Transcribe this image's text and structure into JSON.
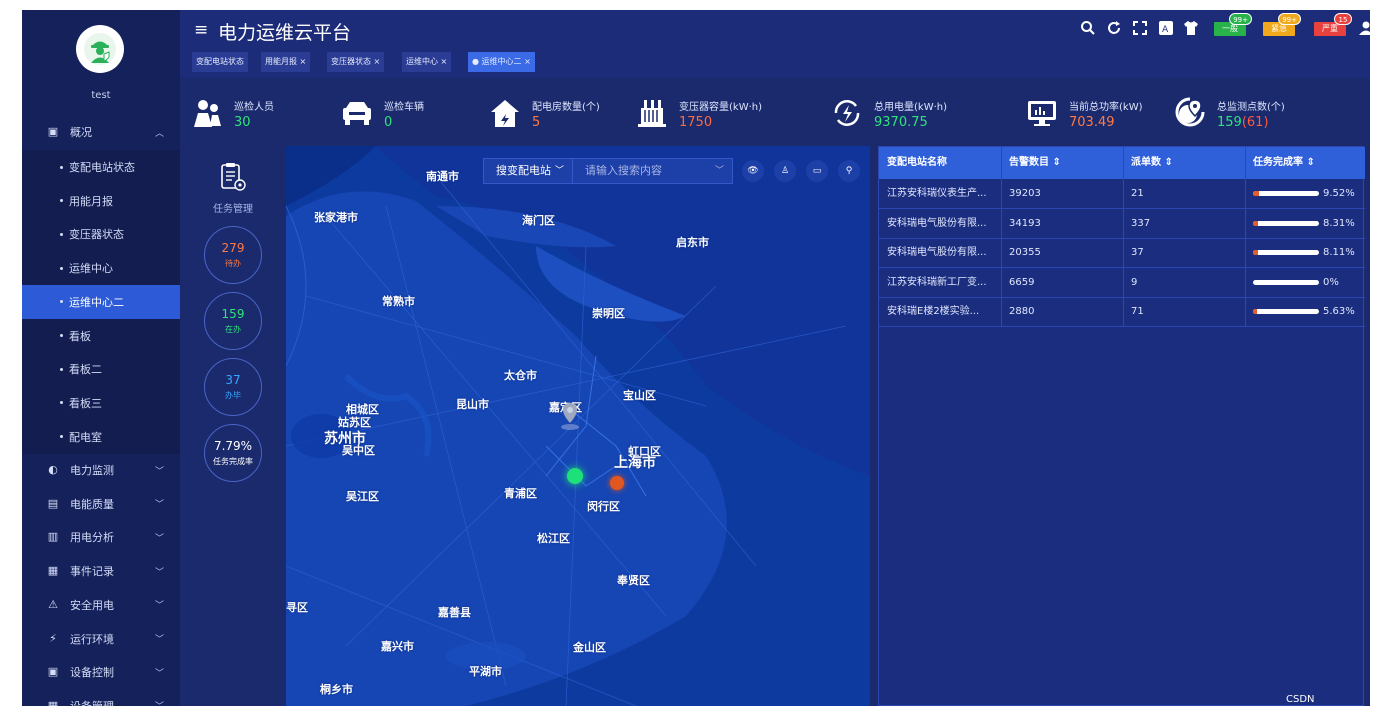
{
  "sidebar": {
    "username": "test",
    "overview": {
      "label": "概况"
    },
    "sub_items": [
      "变配电站状态",
      "用能月报",
      "变压器状态",
      "运维中心",
      "运维中心二",
      "看板",
      "看板二",
      "看板三",
      "配电室"
    ],
    "menu": [
      "电力监测",
      "电能质量",
      "用电分析",
      "事件记录",
      "安全用电",
      "运行环境",
      "设备控制",
      "设备管理"
    ]
  },
  "header": {
    "title": "电力运维云平台",
    "tabs": [
      "变配电站状态",
      "用能月报 ×",
      "变压器状态 ×",
      "运维中心 ×",
      "● 运维中心二 ×"
    ],
    "alerts": [
      {
        "label": "一般",
        "count": "99+",
        "color": "#27b24a"
      },
      {
        "label": "紧急",
        "count": "99+",
        "color": "#f0a81c"
      },
      {
        "label": "严重",
        "count": "15",
        "color": "#e8413e"
      }
    ]
  },
  "stats": [
    {
      "label": "巡检人员",
      "value": "30",
      "color": "#2ee37a"
    },
    {
      "label": "巡检车辆",
      "value": "0",
      "color": "#2ee37a"
    },
    {
      "label": "配电房数量(个)",
      "value": "5",
      "color": "#ff7a45"
    },
    {
      "label": "变压器容量(kW·h)",
      "value": "1750",
      "color": "#ff6a3d"
    },
    {
      "label": "总用电量(kW·h)",
      "value": "9370.75",
      "color": "#2ee37a"
    },
    {
      "label": "当前总功率(kW)",
      "value": "703.49",
      "color": "#ff7a45"
    },
    {
      "label": "总监测点数(个)",
      "value": "159",
      "extra": "(61)",
      "color": "#2ee37a",
      "extra_color": "#ff5a3d"
    }
  ],
  "tasks": {
    "title": "任务管理",
    "items": [
      {
        "value": "279",
        "label": "待办",
        "color": "#ff7a45"
      },
      {
        "value": "159",
        "label": "在办",
        "color": "#2ee37a"
      },
      {
        "value": "37",
        "label": "办毕",
        "color": "#38a6ff"
      },
      {
        "value": "7.79%",
        "label": "任务完成率",
        "color": "#ffffff"
      }
    ]
  },
  "map": {
    "search_type": "搜变配电站",
    "search_placeholder": "请输入搜索内容",
    "cities": [
      "南通市",
      "张家港市",
      "海门区",
      "启东市",
      "常熟市",
      "崇明区",
      "太仓市",
      "昆山市",
      "嘉定区",
      "宝山区",
      "相城区",
      "姑苏区",
      "苏州市",
      "吴中区",
      "虹口区",
      "上海市",
      "吴江区",
      "青浦区",
      "闵行区",
      "松江区",
      "奉贤区",
      "寻区",
      "嘉善县",
      "嘉兴市",
      "金山区",
      "平湖市",
      "桐乡市"
    ]
  },
  "table": {
    "headers": [
      "变配电站名称",
      "告警数目 ⇕",
      "派单数 ⇕",
      "任务完成率 ⇕"
    ],
    "rows": [
      {
        "name": "江苏安科瑞仪表生产...",
        "alarms": "39203",
        "orders": "21",
        "rate": 9.52,
        "rate_label": "9.52%"
      },
      {
        "name": "安科瑞电气股份有限...",
        "alarms": "34193",
        "orders": "337",
        "rate": 8.31,
        "rate_label": "8.31%"
      },
      {
        "name": "安科瑞电气股份有限...",
        "alarms": "20355",
        "orders": "37",
        "rate": 8.11,
        "rate_label": "8.11%"
      },
      {
        "name": "江苏安科瑞新工厂变...",
        "alarms": "6659",
        "orders": "9",
        "rate": 0,
        "rate_label": "0%"
      },
      {
        "name": "安科瑞E楼2楼实验...",
        "alarms": "2880",
        "orders": "71",
        "rate": 5.63,
        "rate_label": "5.63%"
      }
    ]
  },
  "watermark": "CSDN @ACRELKY"
}
